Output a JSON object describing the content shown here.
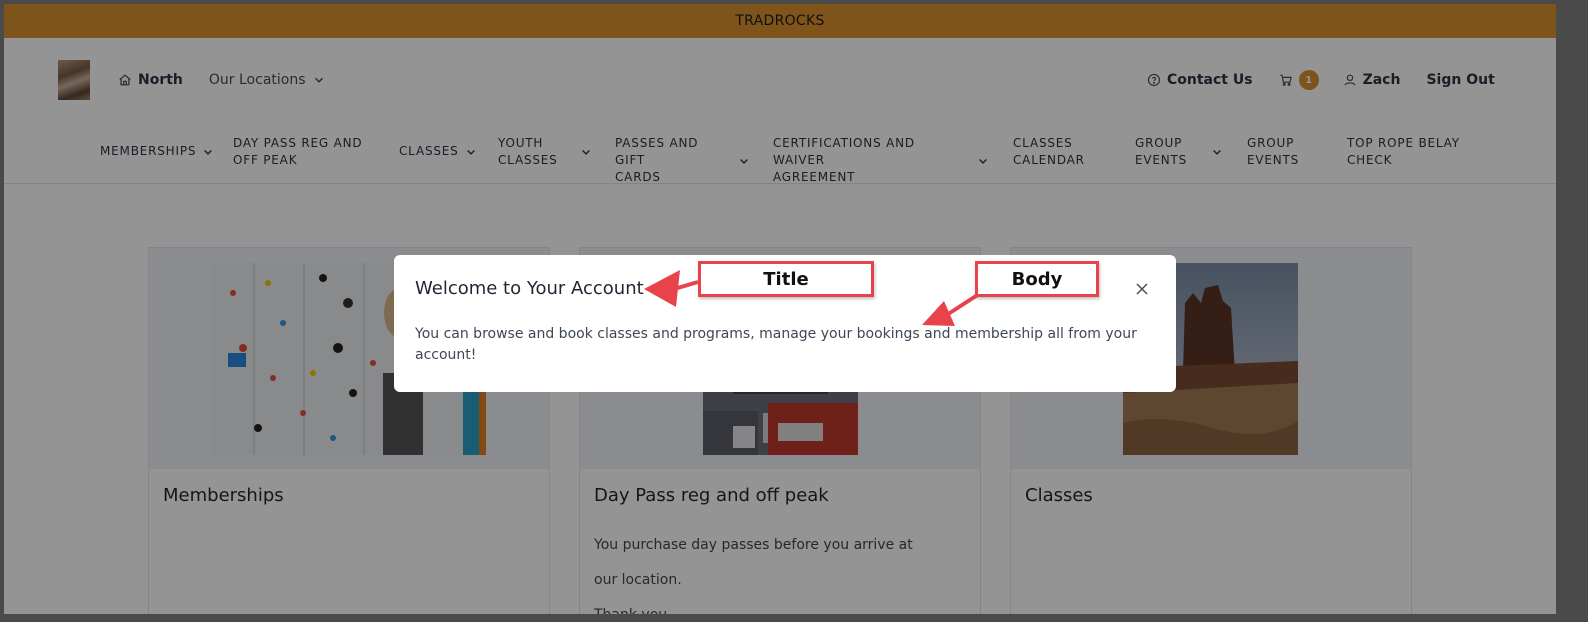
{
  "banner": {
    "text": "TRADROCKS"
  },
  "header": {
    "left_nav": [
      {
        "name": "home-location",
        "label": "North",
        "icon": "home-icon"
      },
      {
        "name": "our-locations",
        "label": "Our Locations",
        "icon": "chevron-down-icon"
      }
    ],
    "right_nav": {
      "contact": "Contact Us",
      "cart_count": "1",
      "user": "Zach",
      "sign_out": "Sign Out"
    },
    "main_nav": [
      {
        "line1": "Memberships",
        "line2": "",
        "dropdown": true
      },
      {
        "line1": "Day pass reg and",
        "line2": "off peak",
        "dropdown": false
      },
      {
        "line1": "Classes",
        "line2": "",
        "dropdown": true
      },
      {
        "line1": "Youth",
        "line2": "classes",
        "dropdown": true
      },
      {
        "line1": "Passes and gift",
        "line2": "cards",
        "dropdown": true
      },
      {
        "line1": "Certifications and waiver",
        "line2": "agreement",
        "dropdown": true
      },
      {
        "line1": "Classes",
        "line2": "Calendar",
        "dropdown": false
      },
      {
        "line1": "Group",
        "line2": "events",
        "dropdown": true
      },
      {
        "line1": "Group",
        "line2": "Events",
        "dropdown": false
      },
      {
        "line1": "Top Rope Belay",
        "line2": "Check",
        "dropdown": false
      }
    ]
  },
  "cards": [
    {
      "title": "Memberships",
      "desc_lines": []
    },
    {
      "title": "Day Pass reg and off peak",
      "desc_lines": [
        "You purchase day passes before you arrive at",
        "our location.",
        "Thank you."
      ]
    },
    {
      "title": "Classes",
      "desc_lines": []
    }
  ],
  "modal": {
    "title": "Welcome to Your Account",
    "body": "You can browse and book classes and programs, manage your bookings and membership all from your account!"
  },
  "annotations": {
    "title_callout": "Title",
    "body_callout": "Body",
    "callout_color": "#e8434a"
  },
  "colors": {
    "accent": "#d9922e",
    "text_dark": "#2b3444"
  }
}
